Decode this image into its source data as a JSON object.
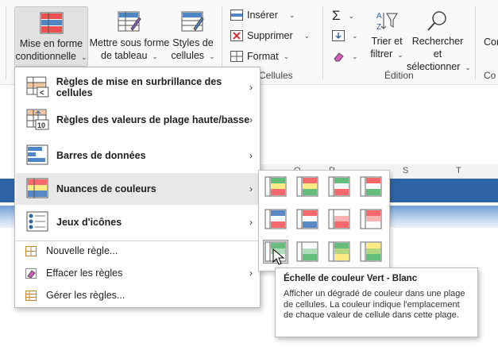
{
  "ribbon": {
    "cond_format": {
      "line1": "Mise en forme",
      "line2": "conditionnelle"
    },
    "table_format": {
      "line1": "Mettre sous forme",
      "line2": "de tableau"
    },
    "cell_styles": {
      "line1": "Styles de",
      "line2": "cellules"
    },
    "insert": "Insérer",
    "delete": "Supprimer",
    "format": "Format",
    "cells_group": "Cellules",
    "sort": {
      "line1": "Trier et",
      "line2": "filtrer"
    },
    "find": {
      "line1": "Rechercher et",
      "line2": "sélectionner"
    },
    "editing_group": "Édition",
    "cut_right1": "Cor",
    "cut_right2": "Co"
  },
  "sheet": {
    "col_o": "O",
    "col_r": "R",
    "col_s": "S",
    "col_t": "T"
  },
  "menu": {
    "items": [
      {
        "label": "Règles de mise en surbrillance des cellules"
      },
      {
        "label": "Règles des valeurs de plage haute/basse"
      },
      {
        "label": "Barres de données"
      },
      {
        "label": "Nuances de couleurs"
      },
      {
        "label": "Jeux d'icônes"
      },
      {
        "label": "Nouvelle règle..."
      },
      {
        "label": "Effacer les règles"
      },
      {
        "label": "Gérer les règles..."
      }
    ]
  },
  "tooltip": {
    "title": "Échelle de couleur Vert - Blanc",
    "body": "Afficher un dégradé de couleur dans une plage de cellules. La couleur indique l'emplacement de chaque valeur de cellule dans cette plage."
  },
  "colors": {
    "accent_blue": "#2e63a6",
    "green": "#63be7b",
    "red": "#f8696b",
    "yellow": "#ffeb84",
    "blue": "#5a8ac6"
  }
}
